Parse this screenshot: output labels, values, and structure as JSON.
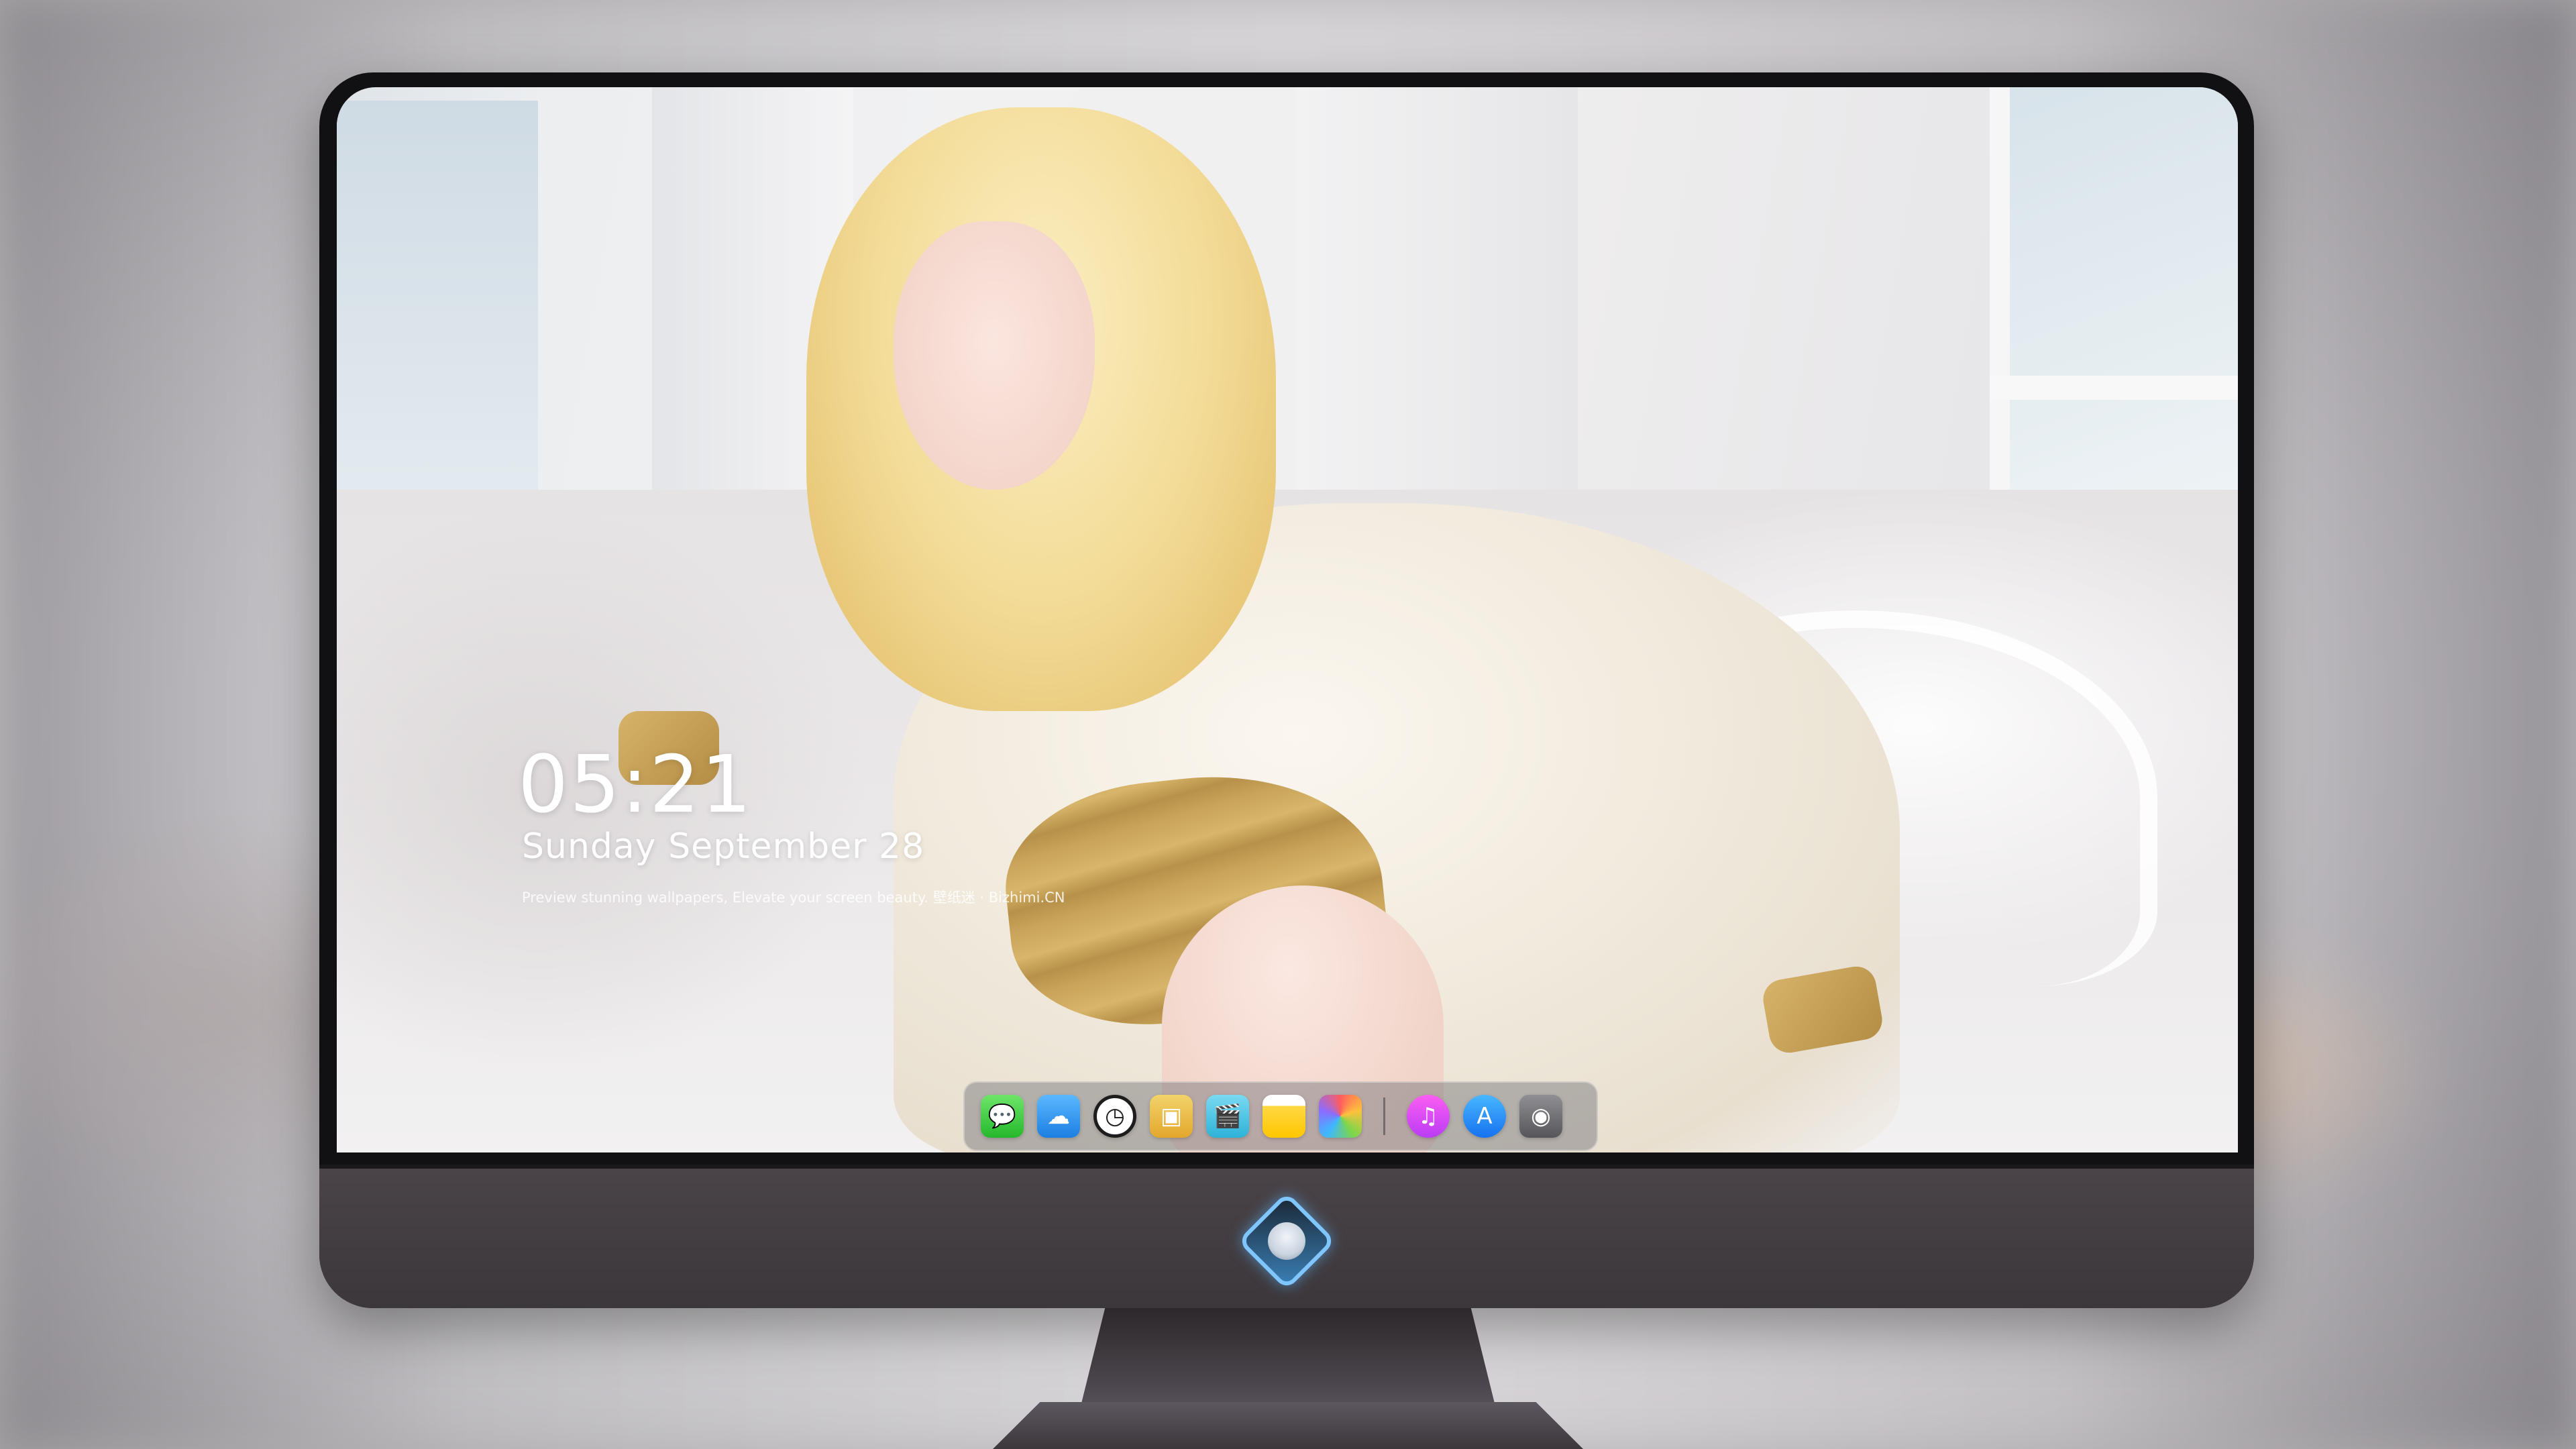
{
  "lock_screen": {
    "time": "05:21",
    "date": "Sunday September  28",
    "tagline": "Preview stunning wallpapers, Elevate your screen beauty. 壁纸迷 · Bizhimi.CN"
  },
  "dock": {
    "apps": [
      {
        "name": "Messages",
        "icon": "message-bubble-icon",
        "glyph": "💬"
      },
      {
        "name": "Weather",
        "icon": "cloud-icon",
        "glyph": "☁"
      },
      {
        "name": "Clock",
        "icon": "clock-icon",
        "glyph": "◷"
      },
      {
        "name": "Preview",
        "icon": "preview-icon",
        "glyph": "▣"
      },
      {
        "name": "Clips",
        "icon": "clapperboard-icon",
        "glyph": "🎬"
      },
      {
        "name": "Notes",
        "icon": "notes-icon",
        "glyph": ""
      },
      {
        "name": "Photos",
        "icon": "photos-icon",
        "glyph": ""
      },
      {
        "name": "Music",
        "icon": "music-note-icon",
        "glyph": "♫"
      },
      {
        "name": "App Store",
        "icon": "app-store-icon",
        "glyph": "A"
      },
      {
        "name": "Camera",
        "icon": "camera-icon",
        "glyph": "◉"
      }
    ]
  },
  "colors": {
    "bezel": "#111013",
    "chin": "#443e42",
    "logo_glow": "#7fc6ff",
    "dock_bg": "rgba(110,110,118,0.45)"
  }
}
